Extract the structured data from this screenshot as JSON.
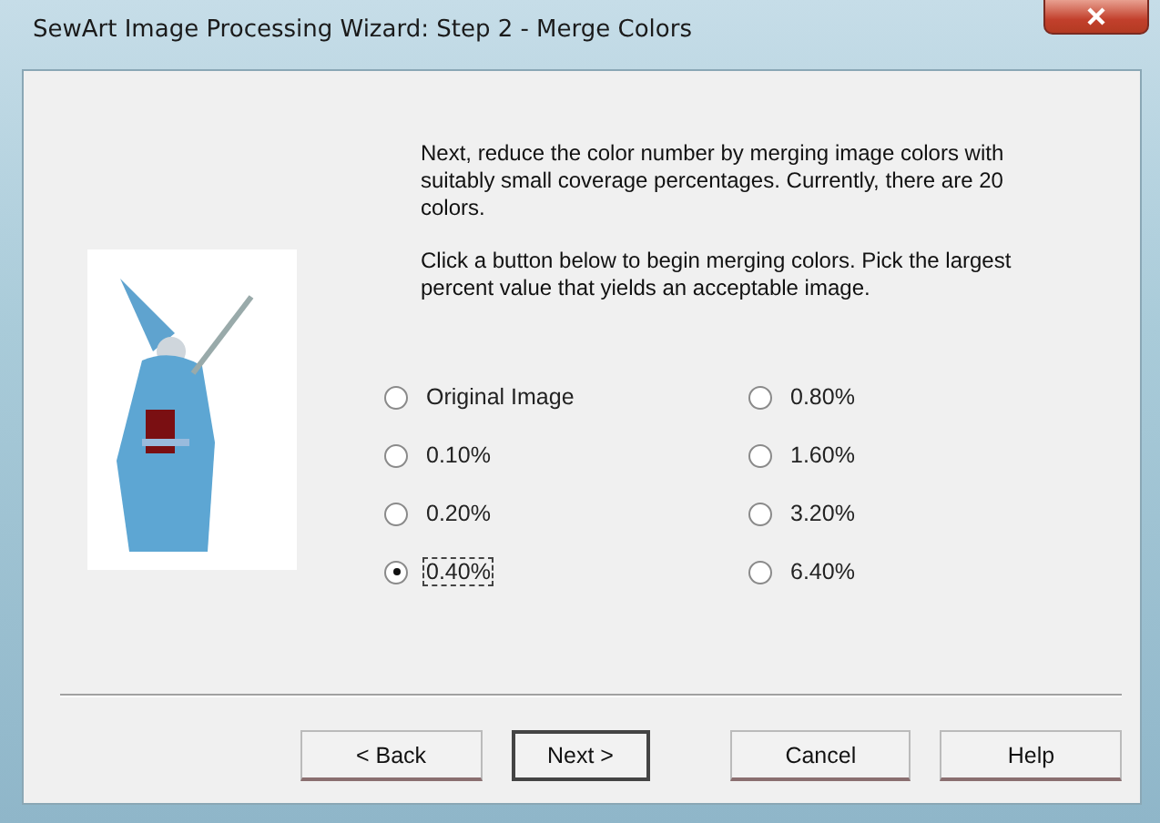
{
  "window": {
    "title": "SewArt Image Processing Wizard: Step 2 - Merge Colors"
  },
  "paragraphs": [
    "Next, reduce the color number by merging image colors  with suitably small coverage percentages. Currently, there are 20 colors.",
    "Click a button below to begin merging colors. Pick the largest percent value that yields an acceptable image."
  ],
  "options": [
    {
      "label": "Original Image",
      "selected": false
    },
    {
      "label": "0.10%",
      "selected": false
    },
    {
      "label": "0.20%",
      "selected": false
    },
    {
      "label": "0.40%",
      "selected": true
    },
    {
      "label": "0.80%",
      "selected": false
    },
    {
      "label": "1.60%",
      "selected": false
    },
    {
      "label": "3.20%",
      "selected": false
    },
    {
      "label": "6.40%",
      "selected": false
    }
  ],
  "buttons": [
    {
      "label": "< Back",
      "default": false
    },
    {
      "label": "Next >",
      "default": true
    },
    {
      "label": "Cancel",
      "default": false
    },
    {
      "label": "Help",
      "default": false
    }
  ]
}
